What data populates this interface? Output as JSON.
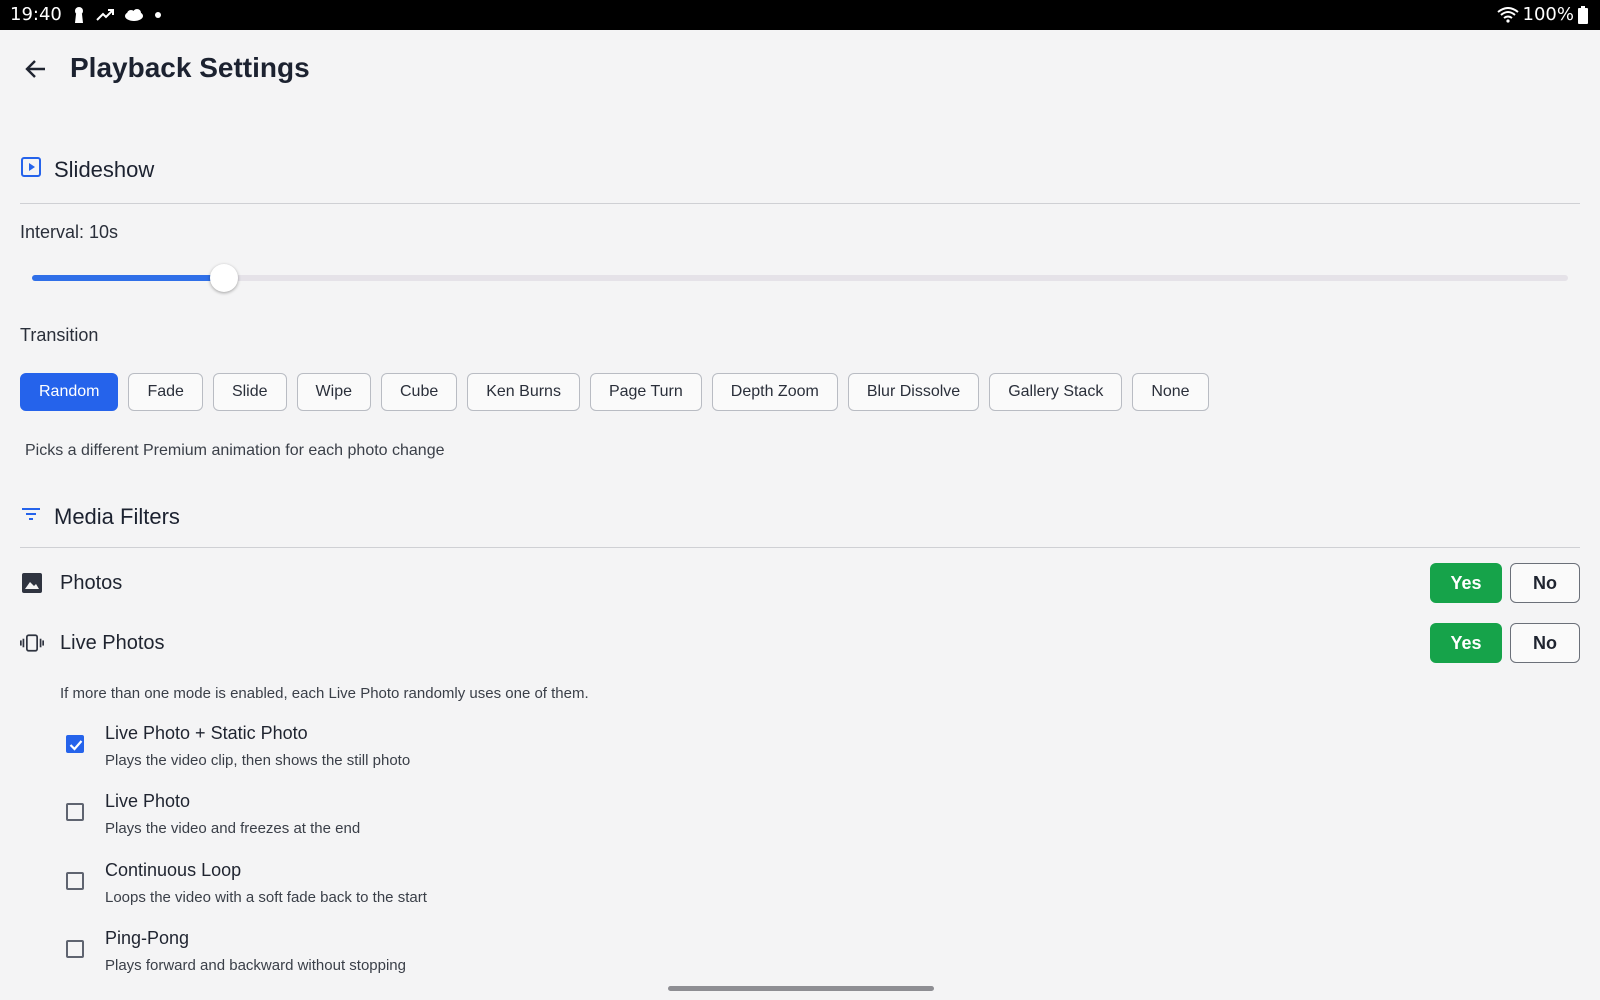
{
  "status_bar": {
    "time": "19:40",
    "battery": "100%"
  },
  "header": {
    "title": "Playback Settings"
  },
  "slideshow": {
    "title": "Slideshow",
    "interval_label": "Interval: 10s",
    "interval_slider_fraction": 0.125,
    "transition_label": "Transition",
    "transitions": [
      "Random",
      "Fade",
      "Slide",
      "Wipe",
      "Cube",
      "Ken Burns",
      "Page Turn",
      "Depth Zoom",
      "Blur Dissolve",
      "Gallery Stack",
      "None"
    ],
    "selected_transition": "Random",
    "transition_hint": "Picks a different Premium animation for each photo change"
  },
  "media_filters": {
    "title": "Media Filters",
    "photos": {
      "label": "Photos",
      "yes": "Yes",
      "no": "No",
      "selected": "Yes"
    },
    "live_photos": {
      "label": "Live Photos",
      "yes": "Yes",
      "no": "No",
      "selected": "Yes"
    },
    "live_hint": "If more than one mode is enabled, each Live Photo randomly uses one of them.",
    "modes": [
      {
        "title": "Live Photo + Static Photo",
        "desc": "Plays the video clip, then shows the still photo",
        "checked": true
      },
      {
        "title": "Live Photo",
        "desc": "Plays the video and freezes at the end",
        "checked": false
      },
      {
        "title": "Continuous Loop",
        "desc": "Loops the video with a soft fade back to the start",
        "checked": false
      },
      {
        "title": "Ping-Pong",
        "desc": "Plays forward and backward without stopping",
        "checked": false
      }
    ]
  },
  "colors": {
    "accent": "#2563eb",
    "yes_green": "#16a34a"
  },
  "icons": {
    "back": "arrow-left-icon",
    "slideshow": "play-square-icon",
    "filters": "filter-lines-icon",
    "photos": "image-icon",
    "live_photos": "vibration-icon",
    "checkbox_checked": "check-icon"
  }
}
